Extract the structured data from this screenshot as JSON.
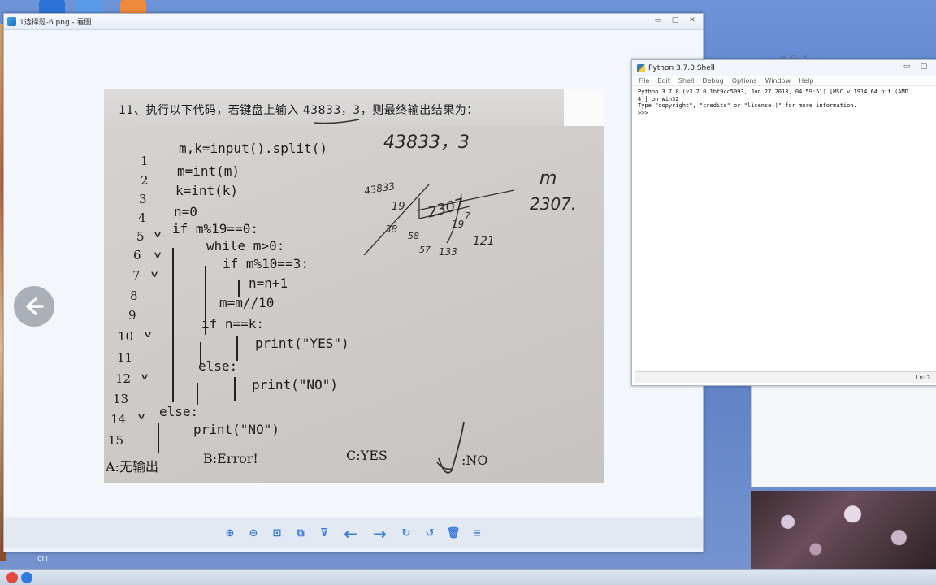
{
  "viewer": {
    "title": "1选择题-6.png - 看图",
    "controls": {
      "minimize": "▭",
      "maximize": "▢",
      "close": "✕"
    },
    "toolbar": [
      {
        "name": "zoom-in-icon",
        "glyph": "⊕"
      },
      {
        "name": "zoom-out-icon",
        "glyph": "⊖"
      },
      {
        "name": "fit-icon",
        "glyph": "⊡"
      },
      {
        "name": "open-folder-icon",
        "glyph": "⧉"
      },
      {
        "name": "slideshow-icon",
        "glyph": "⊽"
      },
      {
        "name": "prev-icon",
        "glyph": "←"
      },
      {
        "name": "next-icon",
        "glyph": "→"
      },
      {
        "name": "rotate-right-icon",
        "glyph": "↻"
      },
      {
        "name": "rotate-left-icon",
        "glyph": "↺"
      },
      {
        "name": "delete-icon",
        "glyph": "🗑"
      },
      {
        "name": "menu-icon",
        "glyph": "≡"
      }
    ],
    "prev_button": "←"
  },
  "paper": {
    "question": "11、执行以下代码，若键盘上输入 43833，3，则最终输出结果为：",
    "line_numbers": [
      "1",
      "2",
      "3",
      "4",
      "5",
      "6",
      "7",
      "8",
      "9",
      "10",
      "11",
      "12",
      "13",
      "14",
      "15"
    ],
    "code": [
      "m,k=input().split()",
      "m=int(m)",
      "k=int(k)",
      "n=0",
      "if m%19==0:",
      "while m>0:",
      "if m%10==3:",
      "n=n+1",
      "m=m//10",
      "if n==k:",
      "print(\"YES\")",
      "else:",
      "print(\"NO\")",
      "else:",
      "print(\"NO\")"
    ],
    "options": {
      "a": "A:无输出",
      "b": "B:Error!",
      "c": "C:YES",
      "d": ":NO"
    },
    "handwriting": {
      "input": "43833，3",
      "m_label": "m",
      "m_value": "2307.",
      "division_dividend": "43833",
      "division_quotient": "2307",
      "n1": "19",
      "n2": "38",
      "n3": "58",
      "n4": "57",
      "n5": "133",
      "n6": "121",
      "n7": "19",
      "n8": "7"
    }
  },
  "shell": {
    "title": "Python 3.7.0 Shell",
    "menu": [
      "File",
      "Edit",
      "Shell",
      "Debug",
      "Options",
      "Window",
      "Help"
    ],
    "lines": [
      "Python 3.7.0 (v3.7.0:1bf9cc5093, Jun 27 2018, 04:59:51) [MSC v.1914 64 bit (AMD",
      "4)] on win32",
      "Type \"copyright\", \"credits\" or \"license()\" for more information.",
      ">>> "
    ],
    "status": "Ln: 3"
  },
  "taskbar": {
    "label": "Chi"
  }
}
